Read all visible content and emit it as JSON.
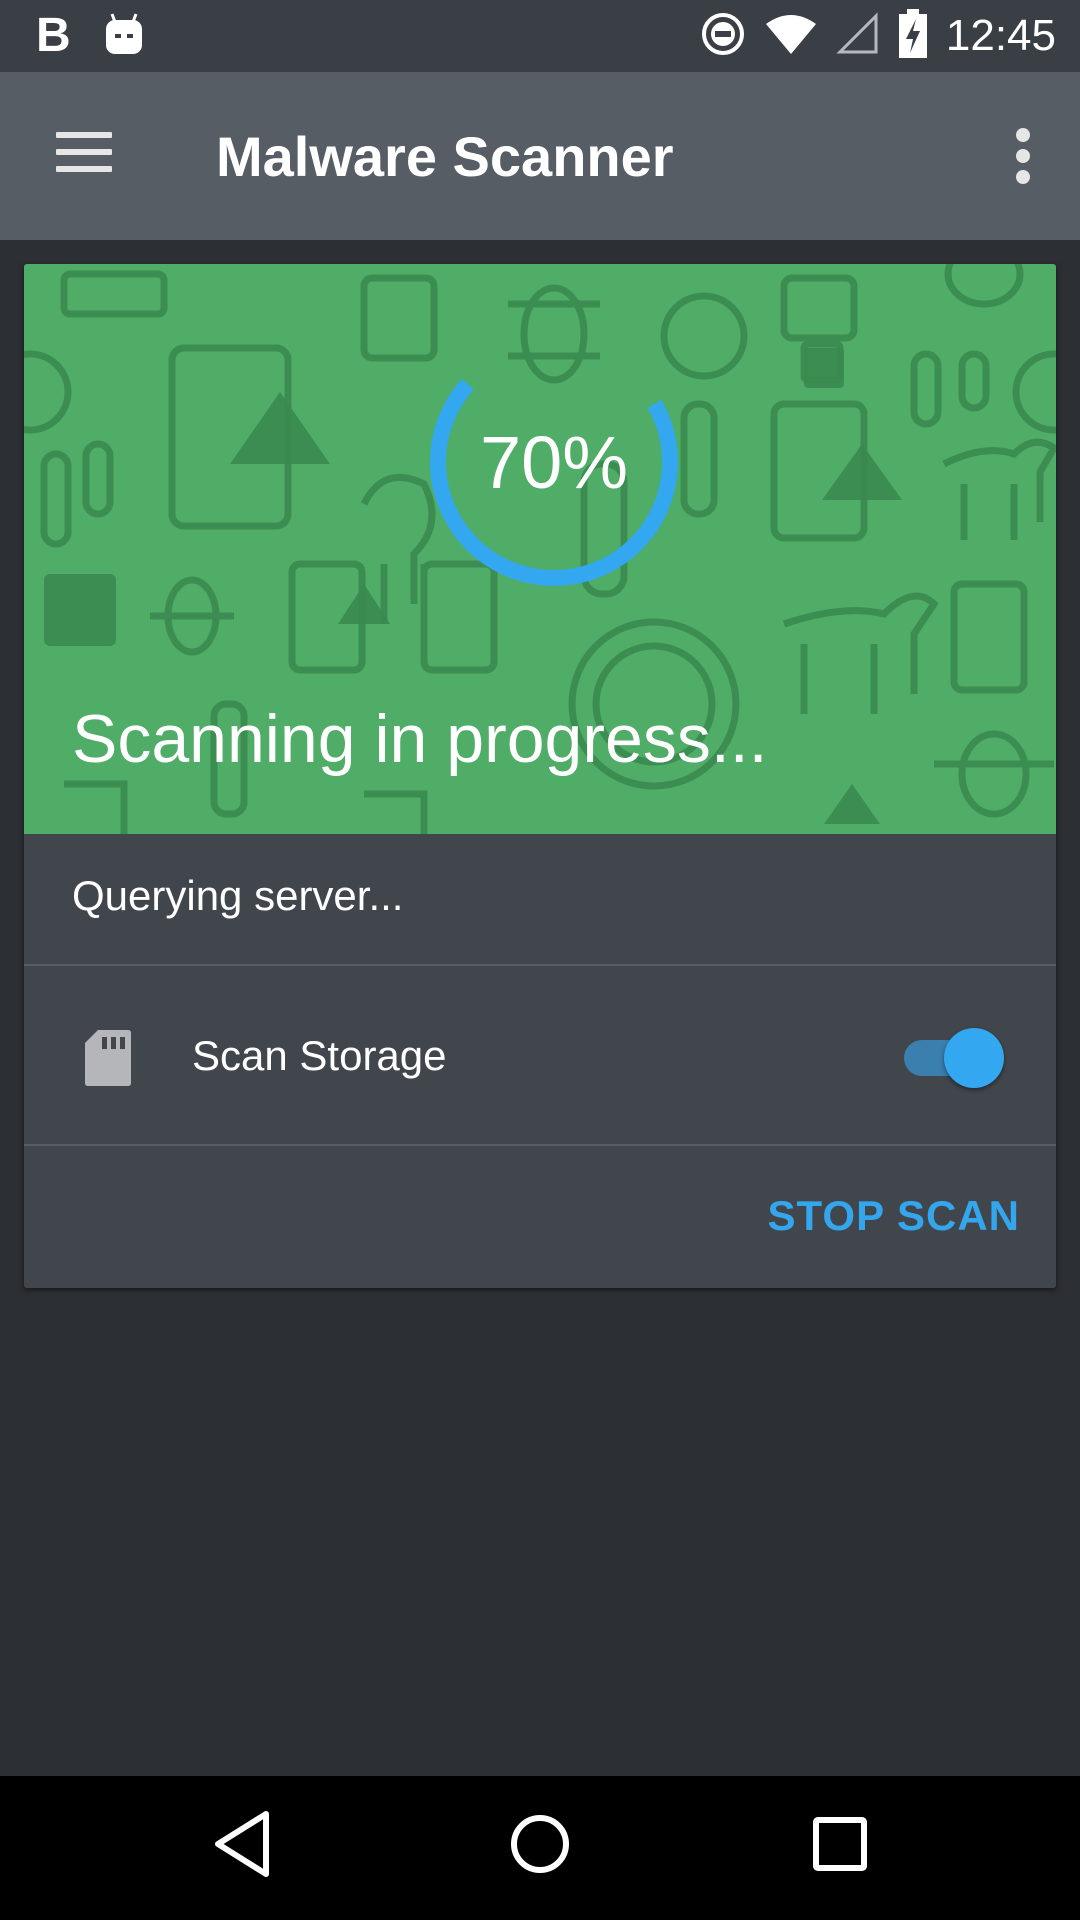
{
  "status_bar": {
    "app_letter": "B",
    "time": "12:45",
    "icons": [
      "b-app-icon",
      "android-notification-icon",
      "do-not-disturb-icon",
      "wifi-icon",
      "cell-signal-icon",
      "battery-charging-icon"
    ]
  },
  "app_bar": {
    "title": "Malware Scanner",
    "menu_icon": "hamburger-menu-icon",
    "overflow_icon": "more-vert-icon"
  },
  "scan_card": {
    "progress_percent": 70,
    "progress_label": "70%",
    "status_title": "Scanning in progress...",
    "progress_color": "#33a7f0",
    "banner_color": "#4fad67"
  },
  "query": {
    "text": "Querying server..."
  },
  "storage": {
    "label": "Scan Storage",
    "icon": "sd-card-icon",
    "enabled": true
  },
  "actions": {
    "stop_label": "STOP SCAN",
    "accent_color": "#34a6ee"
  },
  "nav_bar": {
    "buttons": [
      "back-icon",
      "home-icon",
      "recents-icon"
    ]
  }
}
